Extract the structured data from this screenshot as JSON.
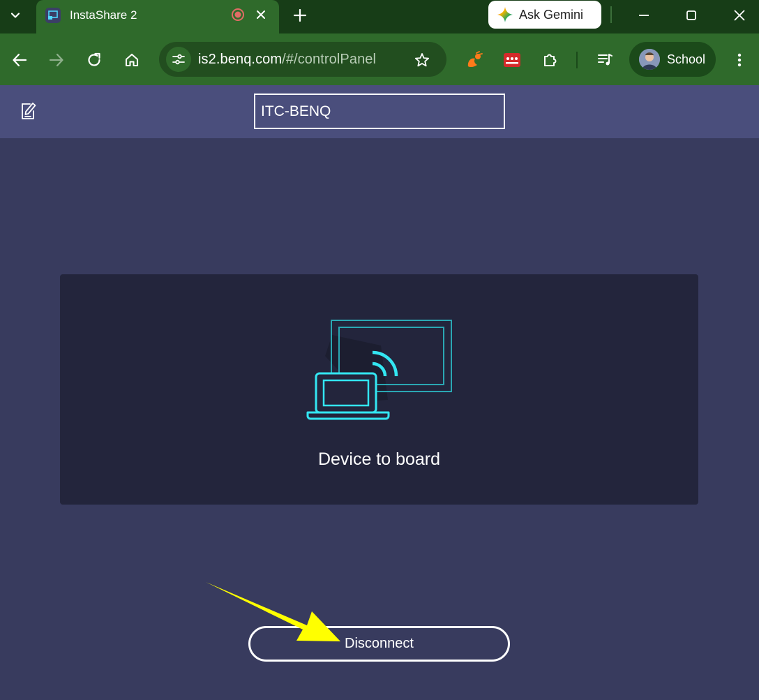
{
  "browser": {
    "tab_title": "InstaShare 2",
    "gemini_label": "Ask Gemini",
    "url_host": "is2.benq.com",
    "url_path": "/#/controlPanel",
    "profile_name": "School",
    "icons": [
      "tab-search-icon",
      "close-icon",
      "plus-icon",
      "minimize-icon",
      "maximize-icon",
      "back-icon",
      "forward-icon",
      "reload-icon",
      "home-icon",
      "tune-icon",
      "star-icon",
      "extension-icon",
      "puzzle-icon",
      "media-queue-icon",
      "more-icon"
    ],
    "colors": {
      "tab_strip": "#173d17",
      "toolbar": "#2f6a2b",
      "recording": "#e06c65"
    }
  },
  "app": {
    "device_name": "ITC-BENQ",
    "mode_label": "Device to board",
    "disconnect_label": "Disconnect",
    "colors": {
      "background": "#383b5e",
      "header": "#4a4e7c",
      "card": "#23253c",
      "accent": "#33e6f2",
      "annotation_arrow": "#ffff00"
    }
  }
}
